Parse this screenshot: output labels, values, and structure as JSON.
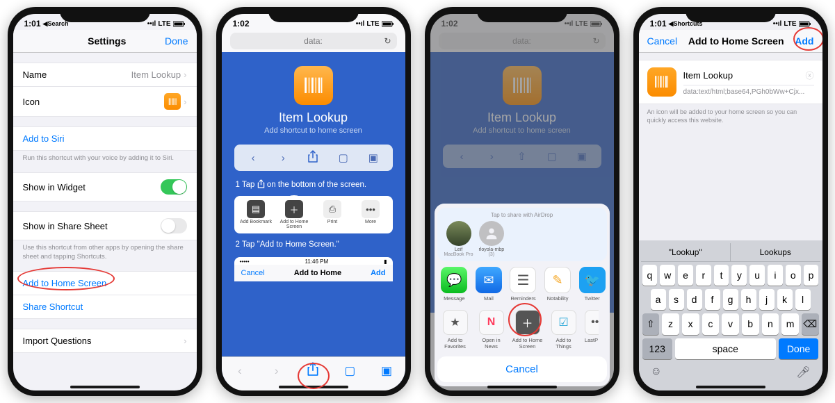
{
  "common": {
    "time": "1:01",
    "time2": "1:02",
    "carrier": "LTE",
    "back_search": "Search",
    "back_shortcuts": "Shortcuts"
  },
  "screen1": {
    "nav_title": "Settings",
    "nav_done": "Done",
    "name_label": "Name",
    "name_value": "Item Lookup",
    "icon_label": "Icon",
    "add_siri": "Add to Siri",
    "siri_footer": "Run this shortcut with your voice by adding it to Siri.",
    "widget_label": "Show in Widget",
    "sharesheet_label": "Show in Share Sheet",
    "sharesheet_footer": "Use this shortcut from other apps by opening the share sheet and tapping Shortcuts.",
    "add_home": "Add to Home Screen",
    "share_shortcut": "Share Shortcut",
    "import_q": "Import Questions"
  },
  "screen2": {
    "url": "data:",
    "title": "Item Lookup",
    "subtitle": "Add shortcut to home screen",
    "step1_pre": "1  Tap",
    "step1_post": "on the bottom of the screen.",
    "a_bookmark": "Add Bookmark",
    "a_home": "Add to Home Screen",
    "a_print": "Print",
    "a_more": "More",
    "step2": "2  Tap \"Add to Home Screen.\"",
    "mini_time": "11:46 PM",
    "mini_cancel": "Cancel",
    "mini_title": "Add to Home",
    "mini_add": "Add"
  },
  "screen3": {
    "url": "data:",
    "title": "Item Lookup",
    "subtitle": "Add shortcut to home screen",
    "airdrop_hint": "Tap to share with AirDrop",
    "person1_name": "Leif",
    "person1_sub": "MacBook Pro",
    "person2_name": "rloyola-mbp",
    "person2_sub": "(3)",
    "app_message": "Message",
    "app_mail": "Mail",
    "app_reminders": "Reminders",
    "app_notability": "Notability",
    "app_twitter": "Twitter",
    "act_fav": "Add to Favorites",
    "act_news": "Open in News",
    "act_home": "Add to Home Screen",
    "act_things": "Add to Things",
    "act_lastpass": "LastP",
    "cancel": "Cancel"
  },
  "screen4": {
    "nav_cancel": "Cancel",
    "nav_title": "Add to Home Screen",
    "nav_add": "Add",
    "name_value": "Item Lookup",
    "url_value": "data:text/html;base64,PGh0bWw+Cjx...",
    "note": "An icon will be added to your home screen so you can quickly access this website.",
    "suggest1": "\"Lookup\"",
    "suggest2": "Lookups",
    "key_123": "123",
    "key_space": "space",
    "key_done": "Done"
  }
}
